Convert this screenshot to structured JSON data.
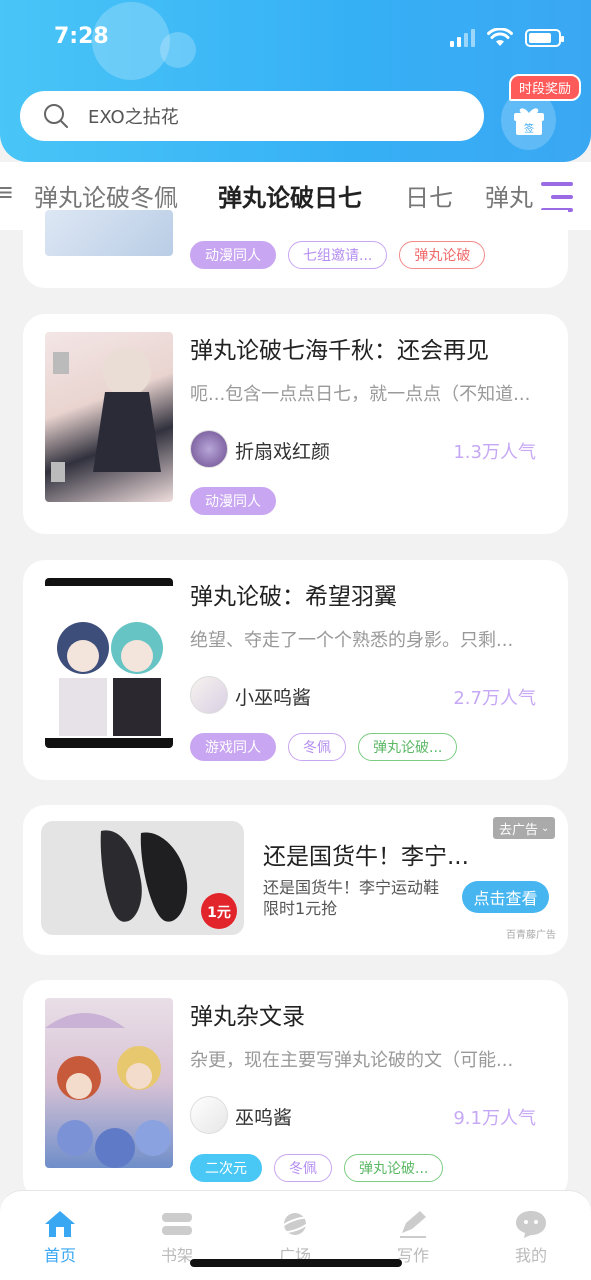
{
  "status": {
    "time": "7:28"
  },
  "search": {
    "placeholder": "EXO之拈花"
  },
  "gift": {
    "badge": "时段奖励",
    "label": "签"
  },
  "tabs": [
    {
      "label": "弹丸论破冬佩"
    },
    {
      "label": "弹丸论破日七"
    },
    {
      "label": "日七"
    },
    {
      "label": "弹丸"
    }
  ],
  "cards": [
    {
      "tags": [
        "动漫同人",
        "七组邀请...",
        "弹丸论破"
      ]
    },
    {
      "title": "弹丸论破七海千秋：还会再见",
      "desc": "呃...包含一点点日七，就一点点（不知道...",
      "author": "折扇戏红颜",
      "popularity": "1.3万人气",
      "tags": [
        "动漫同人"
      ]
    },
    {
      "title": "弹丸论破：希望羽翼",
      "desc": "绝望、夺走了一个个熟悉的身影。只剩...",
      "author": "小巫呜酱",
      "popularity": "2.7万人气",
      "tags": [
        "游戏同人",
        "冬佩",
        "弹丸论破..."
      ]
    },
    {
      "title": "弹丸杂文录",
      "desc": "杂更，现在主要写弹丸论破的文（可能...",
      "author": "巫呜酱",
      "popularity": "9.1万人气",
      "tags": [
        "二次元",
        "冬佩",
        "弹丸论破..."
      ]
    }
  ],
  "ad": {
    "title": "还是国货牛！李宁...",
    "desc": "还是国货牛！李宁运动鞋限时1元抢",
    "button": "点击查看",
    "close": "去广告",
    "source": "百青藤广告",
    "badge": "1元"
  },
  "nav": [
    {
      "label": "首页"
    },
    {
      "label": "书架"
    },
    {
      "label": "广场"
    },
    {
      "label": "写作"
    },
    {
      "label": "我的"
    }
  ],
  "colors": {
    "accent": "#3aa7f3",
    "tag_purple": "#c9a6f1",
    "popularity": "#c6a8f5"
  }
}
